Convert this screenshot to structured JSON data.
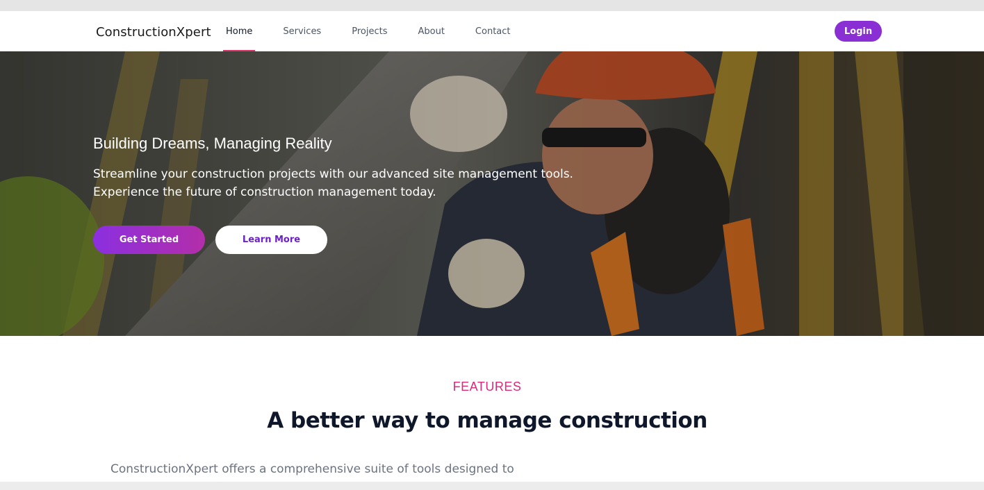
{
  "navbar": {
    "brand": "ConstructionXpert",
    "links": [
      {
        "label": "Home",
        "active": true
      },
      {
        "label": "Services",
        "active": false
      },
      {
        "label": "Projects",
        "active": false
      },
      {
        "label": "About",
        "active": false
      },
      {
        "label": "Contact",
        "active": false
      }
    ],
    "login_label": "Login"
  },
  "hero": {
    "title": "Building Dreams, Managing Reality",
    "subtitle_line1": "Streamline your construction projects with our advanced site management tools.",
    "subtitle_line2": "Experience the future of construction management today.",
    "primary_button": "Get Started",
    "secondary_button": "Learn More"
  },
  "features": {
    "label": "FEATURES",
    "title": "A better way to manage construction",
    "description": "ConstructionXpert offers a comprehensive suite of tools designed to"
  },
  "colors": {
    "accent_purple": "#8a2fd4",
    "accent_pink": "#db2a7a",
    "heading_dark": "#0f172a"
  }
}
